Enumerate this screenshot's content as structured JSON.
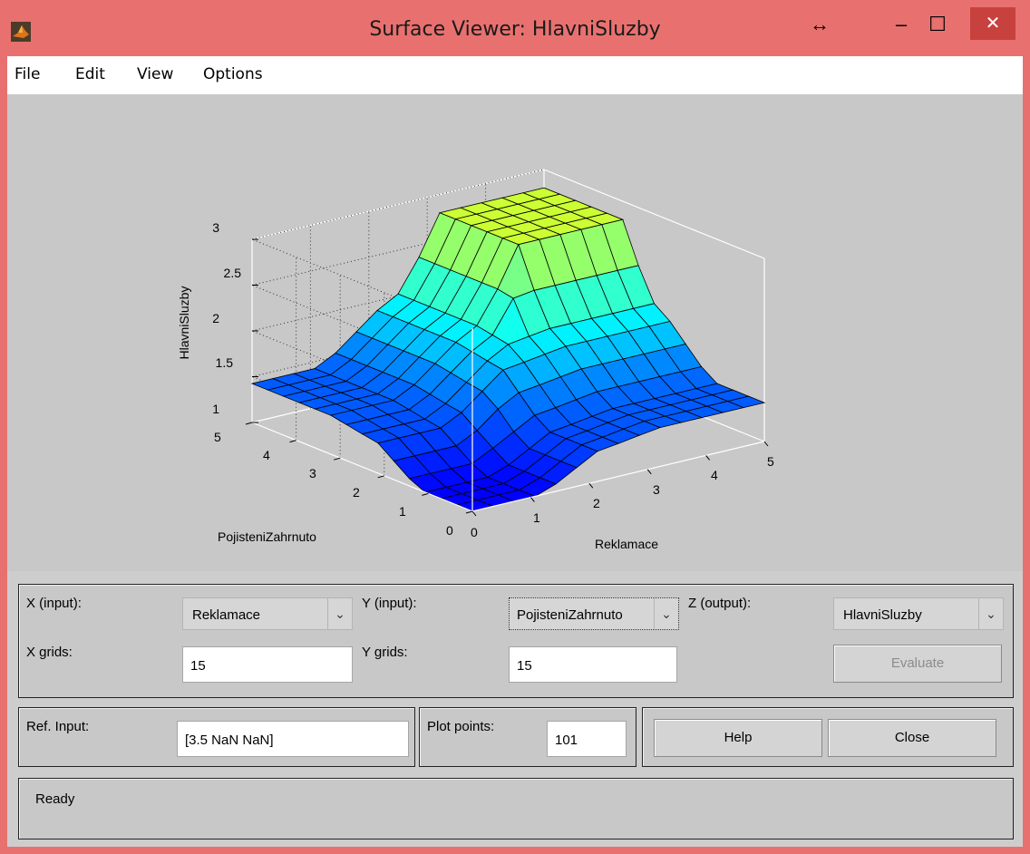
{
  "window": {
    "title": "Surface Viewer: HlavniSluzby",
    "controls": {
      "resize": "↔",
      "minimize": "–",
      "maximize": "☐",
      "close": "✕"
    }
  },
  "menu": {
    "items": [
      "File",
      "Edit",
      "View",
      "Options"
    ]
  },
  "plot": {
    "zlabel": "HlavniSluzby",
    "xlabel": "Reklamace",
    "ylabel": "PojisteniZahrnuto",
    "z_ticks": [
      "3",
      "2.5",
      "2",
      "1.5",
      "1"
    ],
    "x_ticks": [
      "0",
      "1",
      "2",
      "3",
      "4",
      "5"
    ],
    "y_ticks": [
      "0",
      "1",
      "2",
      "3",
      "4",
      "5"
    ]
  },
  "chart_data": {
    "type": "surface",
    "xlabel": "Reklamace",
    "ylabel": "PojisteniZahrnuto",
    "zlabel": "HlavniSluzby",
    "xlim": [
      0,
      5
    ],
    "ylim": [
      0,
      5
    ],
    "zlim": [
      1,
      3
    ],
    "grid": true,
    "x_grid_points": 15,
    "y_grid_points": 15
  },
  "controls": {
    "x_input_label": "X (input):",
    "x_input_value": "Reklamace",
    "y_input_label": "Y (input):",
    "y_input_value": "PojisteniZahrnuto",
    "z_output_label": "Z (output):",
    "z_output_value": "HlavniSluzby",
    "x_grids_label": "X grids:",
    "x_grids_value": "15",
    "y_grids_label": "Y grids:",
    "y_grids_value": "15",
    "evaluate_label": "Evaluate",
    "ref_input_label": "Ref. Input:",
    "ref_input_value": "[3.5 NaN NaN]",
    "plot_points_label": "Plot points:",
    "plot_points_value": "101",
    "help_label": "Help",
    "close_label": "Close"
  },
  "status": {
    "text": "Ready"
  },
  "colors": {
    "titlebar": "#e8716f",
    "close_button": "#c7413f",
    "panel_bg": "#c8c8c8"
  }
}
